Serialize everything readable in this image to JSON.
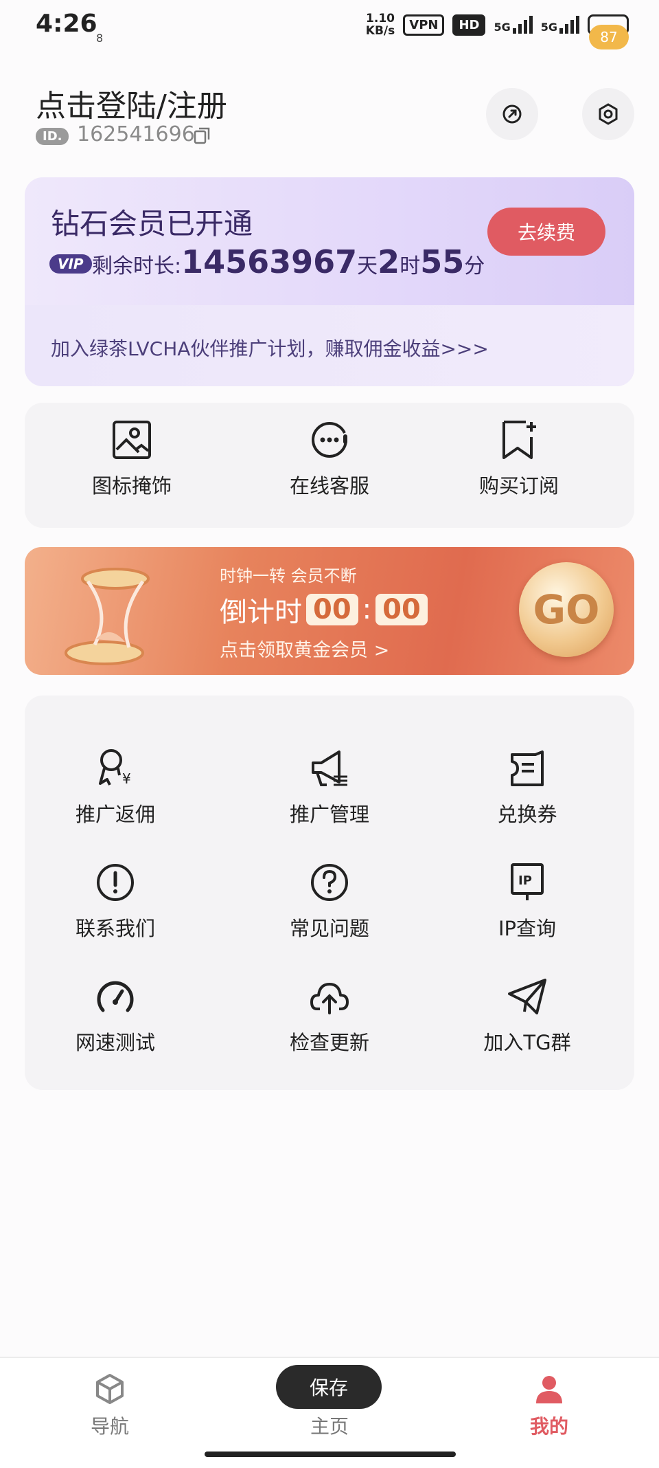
{
  "status_bar": {
    "time": "4:26",
    "small_note": "8",
    "speed_value": "1.10",
    "speed_unit": "KB/s",
    "vpn": "VPN",
    "hd": "HD",
    "sig1": "5G",
    "sig2": "5G",
    "battery_badge": "87"
  },
  "header": {
    "login_label": "点击登陆/注册",
    "id_badge": "ID.",
    "id_value": "162541696"
  },
  "vip": {
    "title": "钻石会员已开通",
    "tag": "VIP",
    "remain_label": "剩余时长:",
    "days": "14563967",
    "days_unit": "天",
    "hours": "2",
    "hours_unit": "时",
    "minutes": "55",
    "minutes_unit": "分",
    "renew_label": "去续费",
    "promo": "加入绿茶LVCHA伙伴推广计划，赚取佣金收益>>>"
  },
  "quick": {
    "items": [
      {
        "label": "图标掩饰",
        "icon": "image-icon"
      },
      {
        "label": "在线客服",
        "icon": "chat-icon"
      },
      {
        "label": "购买订阅",
        "icon": "bookmark-plus-icon"
      }
    ]
  },
  "banner": {
    "subtitle": "时钟一转 会员不断",
    "countdown_label": "倒计时",
    "mm": "00",
    "colon": ":",
    "ss": "00",
    "link": "点击领取黄金会员 >",
    "go": "GO"
  },
  "menu": {
    "items": [
      {
        "label": "推广返佣",
        "icon": "commission-icon"
      },
      {
        "label": "推广管理",
        "icon": "megaphone-icon"
      },
      {
        "label": "兑换券",
        "icon": "ticket-icon"
      },
      {
        "label": "联系我们",
        "icon": "alert-circle-icon"
      },
      {
        "label": "常见问题",
        "icon": "question-icon"
      },
      {
        "label": "IP查询",
        "icon": "ip-icon"
      },
      {
        "label": "网速测试",
        "icon": "speedometer-icon"
      },
      {
        "label": "检查更新",
        "icon": "cloud-upload-icon"
      },
      {
        "label": "加入TG群",
        "icon": "telegram-icon"
      }
    ]
  },
  "toast": {
    "label": "保存"
  },
  "bottom_nav": {
    "items": [
      {
        "label": "导航",
        "icon": "cube-icon",
        "active": false
      },
      {
        "label": "主页",
        "icon": "home-icon",
        "active": false
      },
      {
        "label": "我的",
        "icon": "user-icon",
        "active": true
      }
    ],
    "active_color": "#e05b62"
  },
  "colors": {
    "accent": "#e05b62",
    "vip_text": "#3a2a66"
  }
}
